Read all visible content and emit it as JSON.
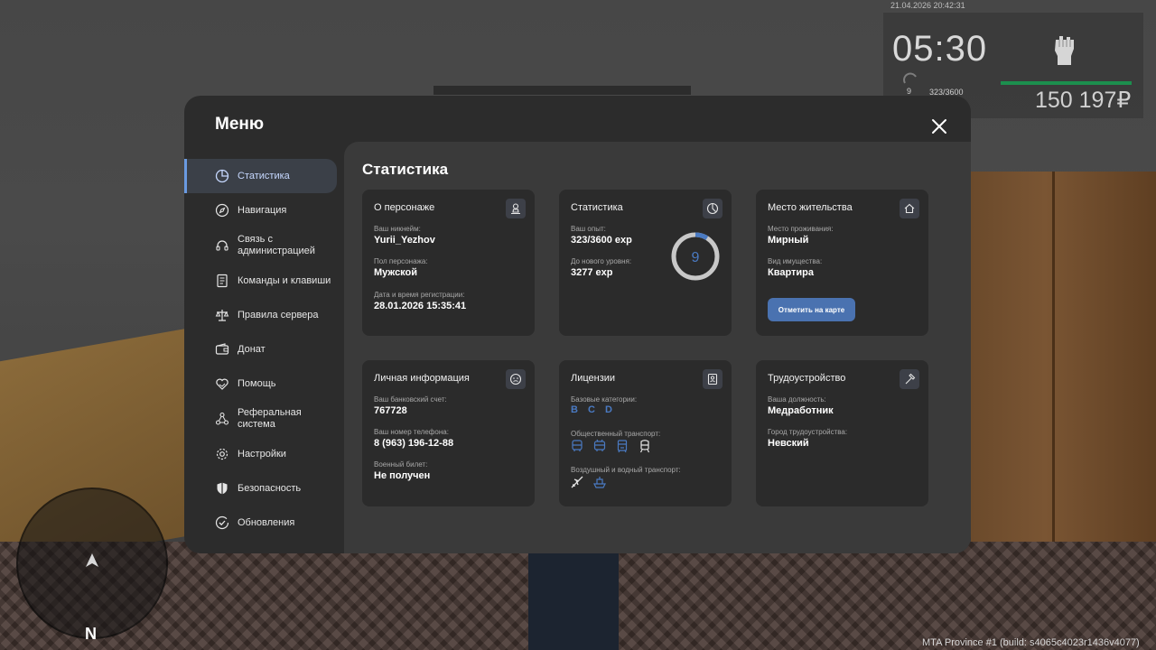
{
  "hud": {
    "datetime": "21.04.2026 20:42:31",
    "clock": "05:30",
    "level": "9",
    "exp": "323/3600",
    "money": "150 197₽",
    "stamina_fraction": 1.0
  },
  "footer": {
    "build": "MTA Province #1 (build: s4065c4023r1436v4077)"
  },
  "minimap": {
    "north": "N"
  },
  "menu": {
    "title": "Меню",
    "sidebar": [
      {
        "label": "Статистика",
        "icon": "pie-chart-icon",
        "active": true
      },
      {
        "label": "Навигация",
        "icon": "compass-icon"
      },
      {
        "label": "Связь с администрацией",
        "icon": "headset-icon"
      },
      {
        "label": "Команды и клавиши",
        "icon": "document-icon"
      },
      {
        "label": "Правила сервера",
        "icon": "scales-icon"
      },
      {
        "label": "Донат",
        "icon": "wallet-icon"
      },
      {
        "label": "Помощь",
        "icon": "heart-hand-icon"
      },
      {
        "label": "Реферальная система",
        "icon": "network-icon"
      },
      {
        "label": "Настройки",
        "icon": "gear-icon"
      },
      {
        "label": "Безопасность",
        "icon": "shield-icon"
      },
      {
        "label": "Обновления",
        "icon": "check-circle-icon"
      }
    ],
    "content_title": "Статистика",
    "character": {
      "title": "О персонаже",
      "nickname_label": "Ваш никнейм:",
      "nickname": "Yurii_Yezhov",
      "gender_label": "Пол персонажа:",
      "gender": "Мужской",
      "reg_label": "Дата и время регистрации:",
      "reg": "28.01.2026 15:35:41"
    },
    "stats": {
      "title": "Статистика",
      "exp_label": "Ваш опыт:",
      "exp": "323/3600 exp",
      "next_label": "До нового уровня:",
      "next": "3277 exp",
      "level": "9",
      "progress": 0.0897
    },
    "residence": {
      "title": "Место жительства",
      "place_label": "Место проживания:",
      "place": "Мирный",
      "property_label": "Вид имущества:",
      "property": "Квартира",
      "map_button": "Отметить на карте"
    },
    "personal": {
      "title": "Личная информация",
      "bank_label": "Ваш банковский счет:",
      "bank": "767728",
      "phone_label": "Ваш номер телефона:",
      "phone": "8 (963) 196-12-88",
      "military_label": "Военный билет:",
      "military": "Не получен"
    },
    "licenses": {
      "title": "Лицензии",
      "base_label": "Базовые категории:",
      "categories": [
        "B",
        "C",
        "D"
      ],
      "public_label": "Общественный транспорт:",
      "air_label": "Воздушный и водный транспорт:",
      "accent": "#4a7ac2"
    },
    "employment": {
      "title": "Трудоустройство",
      "position_label": "Ваша должность:",
      "position": "Медработник",
      "city_label": "Город трудоустройства:",
      "city": "Невский"
    }
  }
}
